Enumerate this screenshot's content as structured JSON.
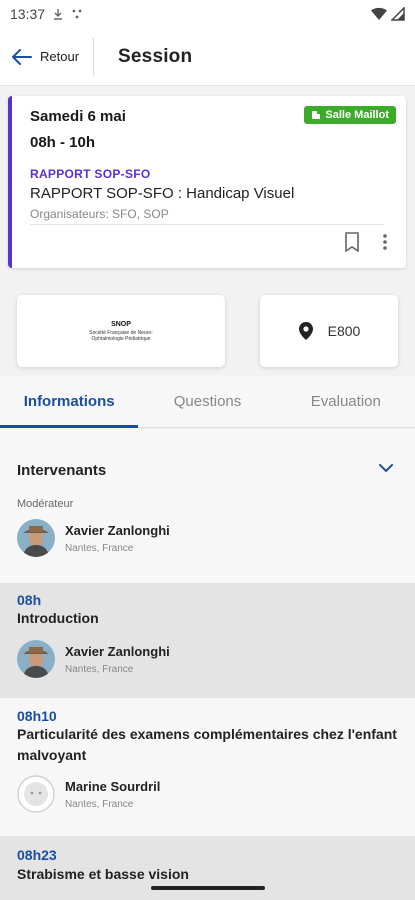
{
  "status": {
    "time": "13:37"
  },
  "header": {
    "back_label": "Retour",
    "title": "Session"
  },
  "session": {
    "date": "Samedi 6 mai",
    "time": "08h - 10h",
    "room": "Salle Maillot",
    "category": "RAPPORT SOP-SFO",
    "title": "RAPPORT SOP-SFO : Handicap Visuel",
    "organizers": "Organisateurs: SFO, SOP",
    "colors": {
      "accent": "#5b2fd0",
      "room_badge": "#3cab2a"
    }
  },
  "sponsor": {
    "logo_text": "SNOP",
    "sub_text": "Société Française de Neuro-Ophtalmologie Pédiatrique"
  },
  "location": {
    "code": "E800"
  },
  "tabs": [
    {
      "label": "Informations",
      "active": true
    },
    {
      "label": "Questions",
      "active": false
    },
    {
      "label": "Evaluation",
      "active": false
    }
  ],
  "intervenants": {
    "title": "Intervenants",
    "role": "Modérateur",
    "moderator": {
      "name": "Xavier Zanlonghi",
      "location": "Nantes, France"
    }
  },
  "talks": [
    {
      "time": "08h",
      "title": "Introduction",
      "speaker": {
        "name": "Xavier Zanlonghi",
        "location": "Nantes, France"
      }
    },
    {
      "time": "08h10",
      "title": "Particularité des examens complémentaires chez l'enfant malvoyant",
      "speaker": {
        "name": "Marine Sourdril",
        "location": "Nantes, France"
      }
    },
    {
      "time": "08h23",
      "title": "Strabisme et basse vision"
    }
  ]
}
